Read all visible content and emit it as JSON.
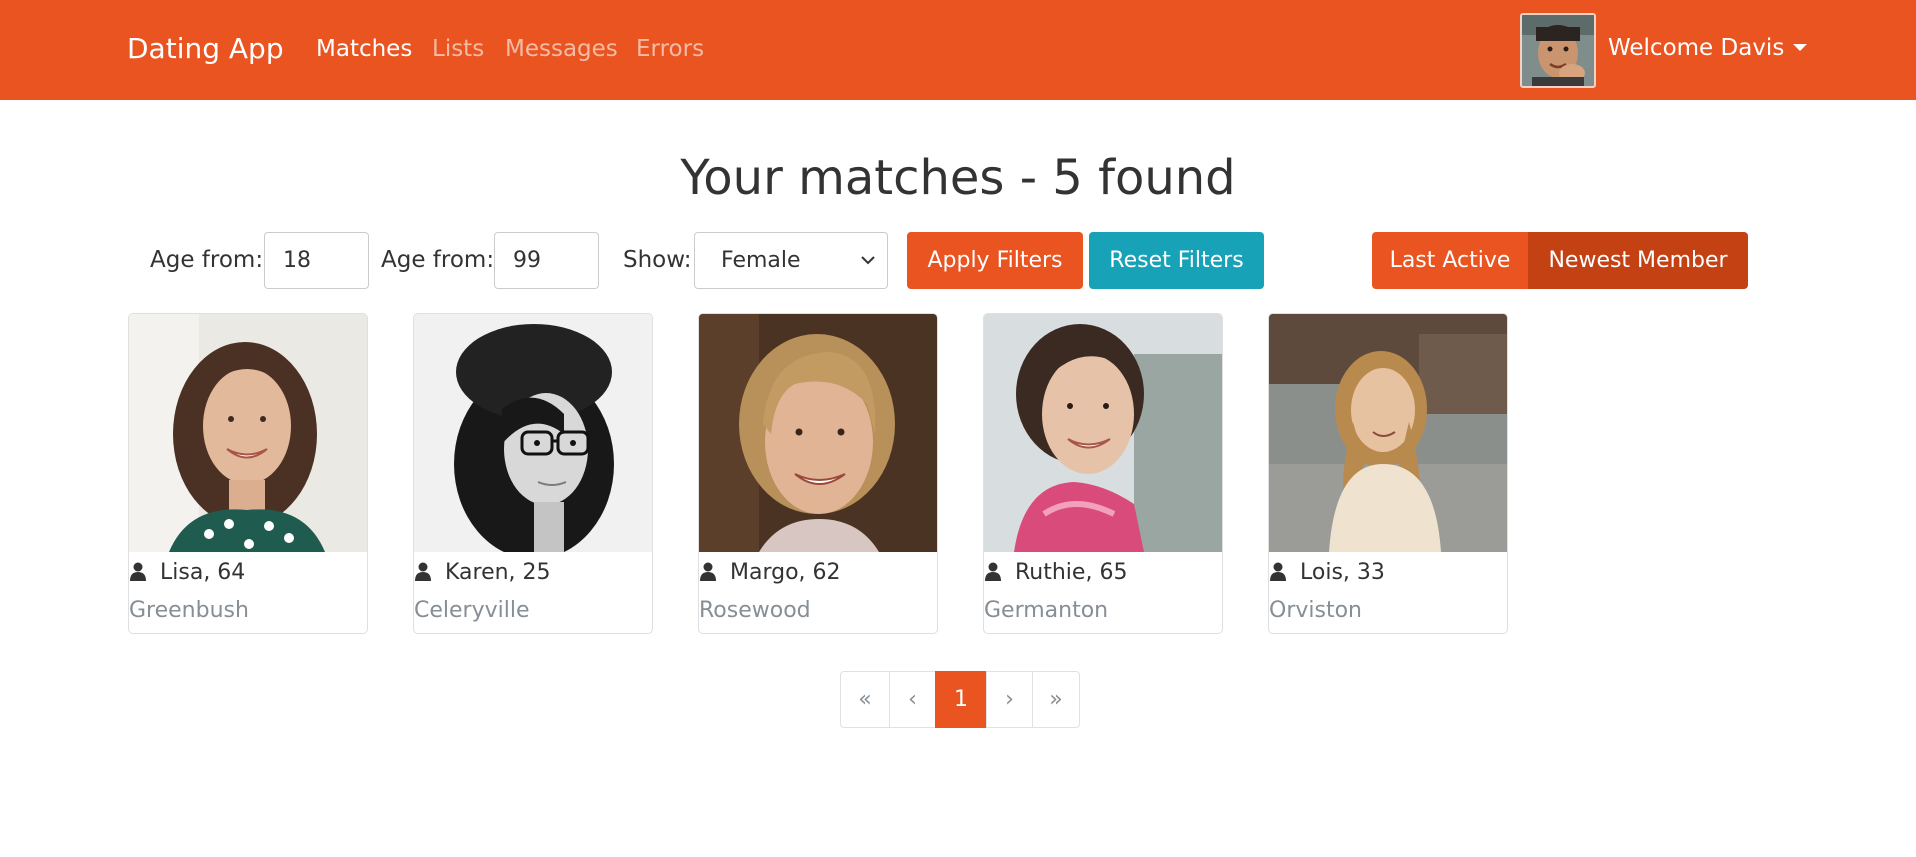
{
  "nav": {
    "brand": "Dating App",
    "links": [
      "Matches",
      "Lists",
      "Messages",
      "Errors"
    ],
    "welcome": "Welcome Davis",
    "accent_color": "#e95420"
  },
  "title": "Your matches - 5 found",
  "filters": {
    "min_label": "Age from:",
    "min_value": "18",
    "max_label": "Age from:",
    "max_value": "99",
    "show_label": "Show:",
    "gender_value": "Female",
    "apply_label": "Apply Filters",
    "reset_label": "Reset Filters",
    "sort_last_active": "Last Active",
    "sort_newest": "Newest Member",
    "reset_color": "#17a2b8"
  },
  "members": [
    {
      "name": "Lisa, 64",
      "city": "Greenbush"
    },
    {
      "name": "Karen, 25",
      "city": "Celeryville"
    },
    {
      "name": "Margo, 62",
      "city": "Rosewood"
    },
    {
      "name": "Ruthie, 65",
      "city": "Germanton"
    },
    {
      "name": "Lois, 33",
      "city": "Orviston"
    }
  ],
  "pagination": {
    "first": "«",
    "prev": "‹",
    "current": "1",
    "next": "›",
    "last": "»"
  },
  "icons": [
    "user-icon",
    "chevron-down-icon",
    "caret-down-icon"
  ]
}
